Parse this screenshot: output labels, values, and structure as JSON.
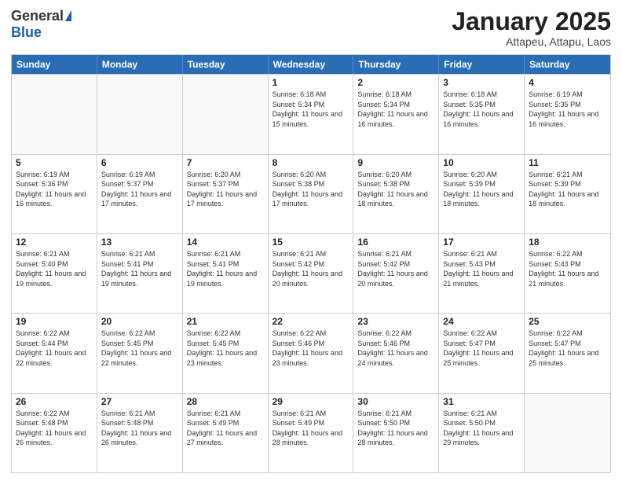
{
  "logo": {
    "general": "General",
    "blue": "Blue"
  },
  "title": "January 2025",
  "location": "Attapeu, Attapu, Laos",
  "weekdays": [
    "Sunday",
    "Monday",
    "Tuesday",
    "Wednesday",
    "Thursday",
    "Friday",
    "Saturday"
  ],
  "weeks": [
    [
      {
        "day": "",
        "text": ""
      },
      {
        "day": "",
        "text": ""
      },
      {
        "day": "",
        "text": ""
      },
      {
        "day": "1",
        "text": "Sunrise: 6:18 AM\nSunset: 5:34 PM\nDaylight: 11 hours and 15 minutes."
      },
      {
        "day": "2",
        "text": "Sunrise: 6:18 AM\nSunset: 5:34 PM\nDaylight: 11 hours and 16 minutes."
      },
      {
        "day": "3",
        "text": "Sunrise: 6:18 AM\nSunset: 5:35 PM\nDaylight: 11 hours and 16 minutes."
      },
      {
        "day": "4",
        "text": "Sunrise: 6:19 AM\nSunset: 5:35 PM\nDaylight: 11 hours and 16 minutes."
      }
    ],
    [
      {
        "day": "5",
        "text": "Sunrise: 6:19 AM\nSunset: 5:36 PM\nDaylight: 11 hours and 16 minutes."
      },
      {
        "day": "6",
        "text": "Sunrise: 6:19 AM\nSunset: 5:37 PM\nDaylight: 11 hours and 17 minutes."
      },
      {
        "day": "7",
        "text": "Sunrise: 6:20 AM\nSunset: 5:37 PM\nDaylight: 11 hours and 17 minutes."
      },
      {
        "day": "8",
        "text": "Sunrise: 6:20 AM\nSunset: 5:38 PM\nDaylight: 11 hours and 17 minutes."
      },
      {
        "day": "9",
        "text": "Sunrise: 6:20 AM\nSunset: 5:38 PM\nDaylight: 11 hours and 18 minutes."
      },
      {
        "day": "10",
        "text": "Sunrise: 6:20 AM\nSunset: 5:39 PM\nDaylight: 11 hours and 18 minutes."
      },
      {
        "day": "11",
        "text": "Sunrise: 6:21 AM\nSunset: 5:39 PM\nDaylight: 11 hours and 18 minutes."
      }
    ],
    [
      {
        "day": "12",
        "text": "Sunrise: 6:21 AM\nSunset: 5:40 PM\nDaylight: 11 hours and 19 minutes."
      },
      {
        "day": "13",
        "text": "Sunrise: 6:21 AM\nSunset: 5:41 PM\nDaylight: 11 hours and 19 minutes."
      },
      {
        "day": "14",
        "text": "Sunrise: 6:21 AM\nSunset: 5:41 PM\nDaylight: 11 hours and 19 minutes."
      },
      {
        "day": "15",
        "text": "Sunrise: 6:21 AM\nSunset: 5:42 PM\nDaylight: 11 hours and 20 minutes."
      },
      {
        "day": "16",
        "text": "Sunrise: 6:21 AM\nSunset: 5:42 PM\nDaylight: 11 hours and 20 minutes."
      },
      {
        "day": "17",
        "text": "Sunrise: 6:21 AM\nSunset: 5:43 PM\nDaylight: 11 hours and 21 minutes."
      },
      {
        "day": "18",
        "text": "Sunrise: 6:22 AM\nSunset: 5:43 PM\nDaylight: 11 hours and 21 minutes."
      }
    ],
    [
      {
        "day": "19",
        "text": "Sunrise: 6:22 AM\nSunset: 5:44 PM\nDaylight: 11 hours and 22 minutes."
      },
      {
        "day": "20",
        "text": "Sunrise: 6:22 AM\nSunset: 5:45 PM\nDaylight: 11 hours and 22 minutes."
      },
      {
        "day": "21",
        "text": "Sunrise: 6:22 AM\nSunset: 5:45 PM\nDaylight: 11 hours and 23 minutes."
      },
      {
        "day": "22",
        "text": "Sunrise: 6:22 AM\nSunset: 5:46 PM\nDaylight: 11 hours and 23 minutes."
      },
      {
        "day": "23",
        "text": "Sunrise: 6:22 AM\nSunset: 5:46 PM\nDaylight: 11 hours and 24 minutes."
      },
      {
        "day": "24",
        "text": "Sunrise: 6:22 AM\nSunset: 5:47 PM\nDaylight: 11 hours and 25 minutes."
      },
      {
        "day": "25",
        "text": "Sunrise: 6:22 AM\nSunset: 5:47 PM\nDaylight: 11 hours and 25 minutes."
      }
    ],
    [
      {
        "day": "26",
        "text": "Sunrise: 6:22 AM\nSunset: 5:48 PM\nDaylight: 11 hours and 26 minutes."
      },
      {
        "day": "27",
        "text": "Sunrise: 6:21 AM\nSunset: 5:48 PM\nDaylight: 11 hours and 26 minutes."
      },
      {
        "day": "28",
        "text": "Sunrise: 6:21 AM\nSunset: 5:49 PM\nDaylight: 11 hours and 27 minutes."
      },
      {
        "day": "29",
        "text": "Sunrise: 6:21 AM\nSunset: 5:49 PM\nDaylight: 11 hours and 28 minutes."
      },
      {
        "day": "30",
        "text": "Sunrise: 6:21 AM\nSunset: 5:50 PM\nDaylight: 11 hours and 28 minutes."
      },
      {
        "day": "31",
        "text": "Sunrise: 6:21 AM\nSunset: 5:50 PM\nDaylight: 11 hours and 29 minutes."
      },
      {
        "day": "",
        "text": ""
      }
    ]
  ]
}
